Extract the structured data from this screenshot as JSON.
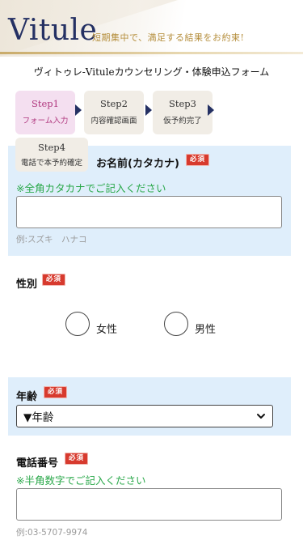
{
  "header": {
    "logo": "Vitule",
    "tagline": "短期集中で、満足する結果をお約束!"
  },
  "form_title": "ヴィトゥレ-Vituleカウンセリング・体験申込フォーム",
  "steps": [
    {
      "no": "Step1",
      "text": "フォーム入力",
      "active": true
    },
    {
      "no": "Step2",
      "text": "内容確認画面",
      "active": false
    },
    {
      "no": "Step3",
      "text": "仮予約完了",
      "active": false
    },
    {
      "no": "Step4",
      "text": "電話で本予約確定",
      "active": false
    }
  ],
  "fields": {
    "name_kana": {
      "label": "お名前(カタカナ)",
      "required": "必須",
      "hint": "※全角カタカナでご記入ください",
      "value": "",
      "example": "例:スズキ　ハナコ"
    },
    "gender": {
      "label": "性別",
      "required": "必須",
      "options": [
        "女性",
        "男性"
      ]
    },
    "age": {
      "label": "年齢",
      "required": "必須",
      "selected": "▼年齢"
    },
    "phone": {
      "label": "電話番号",
      "required": "必須",
      "hint": "※半角数字でご記入ください",
      "value": "",
      "example": "例:03-5707-9974"
    }
  },
  "icons": {
    "step_arrow": "triangle-right-icon",
    "select_chevron": "chevron-down-icon"
  },
  "colors": {
    "brand_navy": "#243063",
    "brand_gold": "#b58e3c",
    "active_step": "#f4dff0",
    "required": "#d73a2e",
    "hint_green": "#2aa84a",
    "section_blue": "#dfeefb"
  }
}
